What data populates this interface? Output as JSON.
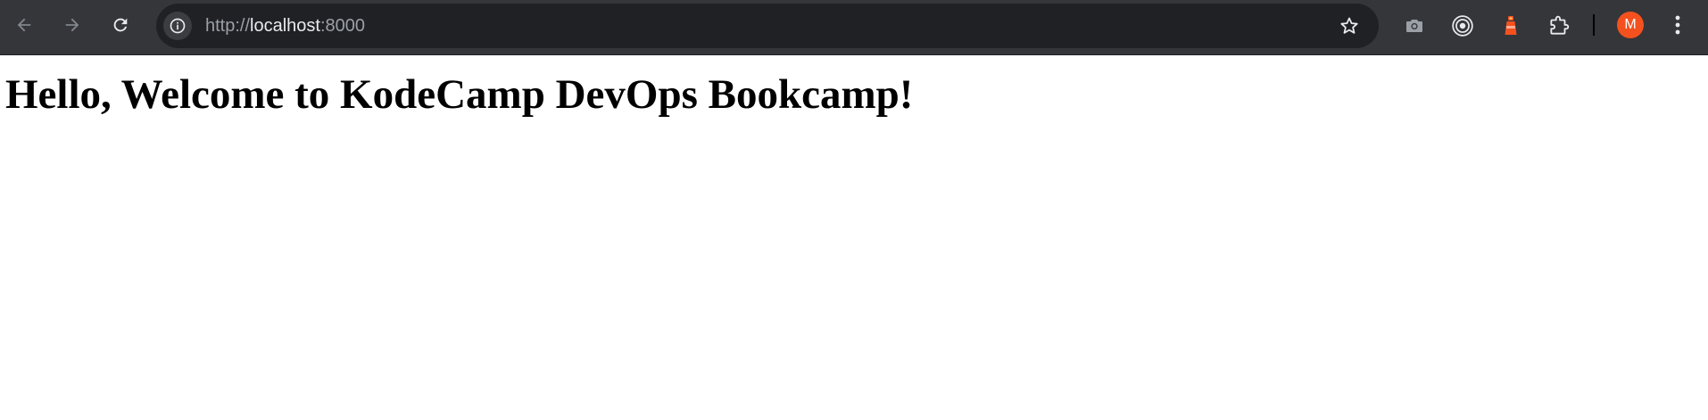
{
  "browser": {
    "url": {
      "scheme": "http://",
      "host": "localhost",
      "port": ":8000"
    },
    "icons": {
      "back": "arrow-left-icon",
      "forward": "arrow-right-icon",
      "reload": "reload-icon",
      "site_info": "info-icon",
      "bookmark": "star-icon",
      "ext1": "camera-icon",
      "ext2": "target-icon",
      "ext3": "lighthouse-icon",
      "ext4": "puzzle-icon",
      "menu": "kebab-menu-icon"
    },
    "profile_initial": "M",
    "colors": {
      "toolbar": "#35363a",
      "omnibox": "#202124",
      "avatar": "#f4511e",
      "lighthouse": "#f4511e"
    }
  },
  "page": {
    "heading": "Hello, Welcome to KodeCamp DevOps Bookcamp!"
  }
}
